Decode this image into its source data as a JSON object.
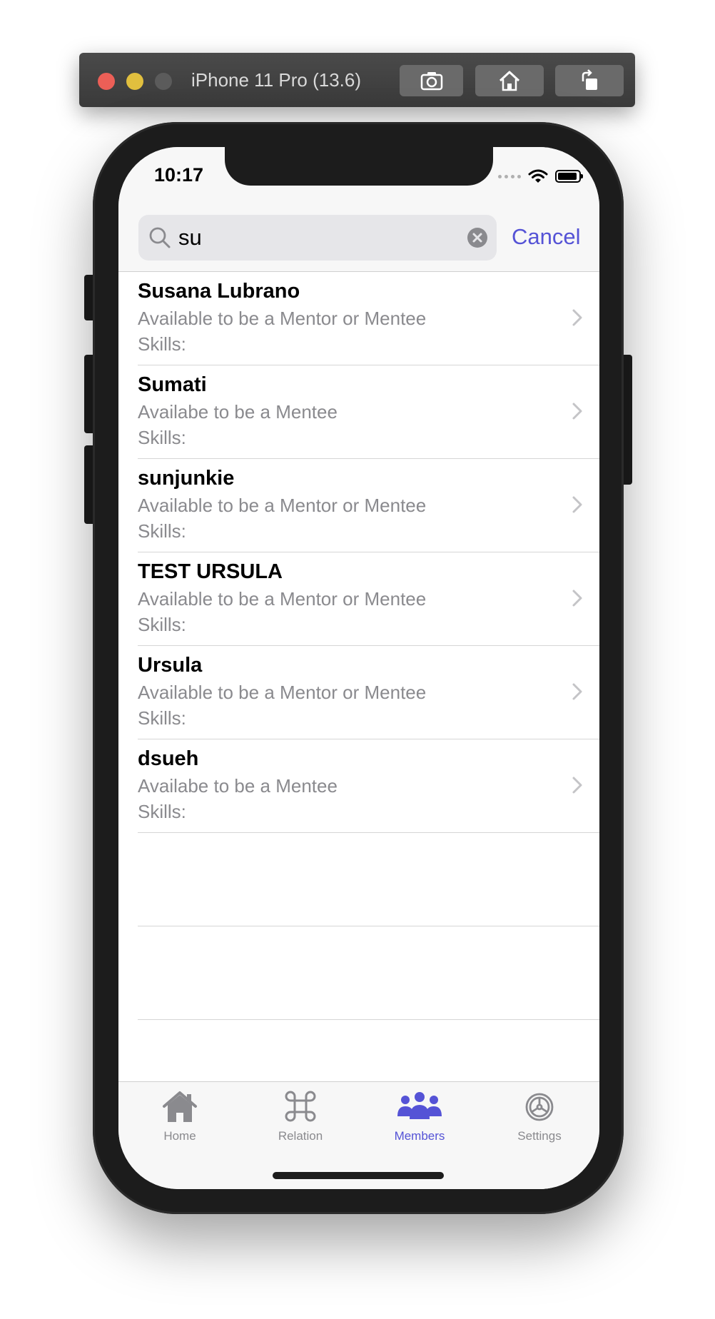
{
  "simulator": {
    "title": "iPhone 11 Pro (13.6)",
    "buttons": [
      "screenshot-icon",
      "home-icon",
      "rotate-icon"
    ]
  },
  "status_bar": {
    "time": "10:17"
  },
  "search": {
    "value": "su",
    "cancel_label": "Cancel"
  },
  "results": [
    {
      "name": "Susana Lubrano",
      "availability": "Available to be a Mentor or Mentee",
      "skills": "Skills:"
    },
    {
      "name": "Sumati",
      "availability": "Availabe to be a Mentee",
      "skills": "Skills:"
    },
    {
      "name": "sunjunkie",
      "availability": "Available to be a Mentor or Mentee",
      "skills": "Skills:"
    },
    {
      "name": "TEST URSULA",
      "availability": "Available to be a Mentor or Mentee",
      "skills": "Skills:"
    },
    {
      "name": "Ursula",
      "availability": "Available to be a Mentor or Mentee",
      "skills": "Skills:"
    },
    {
      "name": "dsueh",
      "availability": "Availabe to be a Mentee",
      "skills": "Skills:"
    }
  ],
  "tabs": [
    {
      "label": "Home",
      "icon": "house-icon",
      "active": false
    },
    {
      "label": "Relation",
      "icon": "command-icon",
      "active": false
    },
    {
      "label": "Members",
      "icon": "people-icon",
      "active": true
    },
    {
      "label": "Settings",
      "icon": "gear-icon",
      "active": false
    }
  ],
  "colors": {
    "accent": "#5553d6",
    "inactive_tab": "#8a8a8e"
  }
}
